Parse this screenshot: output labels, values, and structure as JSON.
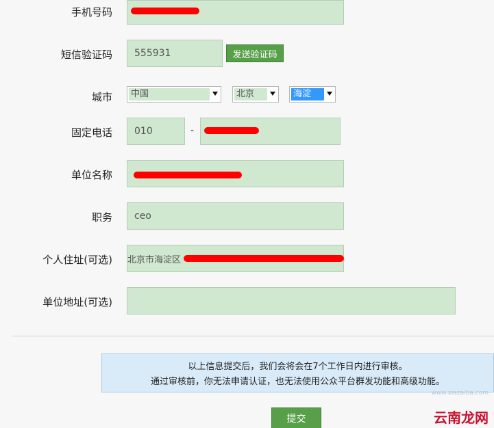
{
  "form": {
    "phone": {
      "label": "手机号码",
      "value": ""
    },
    "sms_code": {
      "label": "短信验证码",
      "value": "555931",
      "send_button": "发送验证码"
    },
    "city": {
      "label": "城市",
      "country": "中国",
      "province": "北京",
      "district": "海淀"
    },
    "landline": {
      "label": "固定电话",
      "area_code": "010",
      "separator": "-",
      "number": ""
    },
    "company_name": {
      "label": "单位名称",
      "value": ""
    },
    "position": {
      "label": "职务",
      "value": "ceo"
    },
    "home_address": {
      "label": "个人住址(可选)",
      "value_prefix": "北京市海淀区"
    },
    "company_address": {
      "label": "单位地址(可选)",
      "value": ""
    }
  },
  "notice": {
    "line1": "以上信息提交后，我们会将会在7个工作日内进行审核。",
    "line2": "通过审核前，你无法申请认证，也无法使用公众平台群发功能和高级功能。"
  },
  "submit_label": "提交",
  "watermark": {
    "brand": "云南龙网",
    "url": "www.xiazaiba.com"
  },
  "colors": {
    "field_bg": "#cfe8cf",
    "button_green": "#57a049",
    "notice_bg": "#d9ebf9",
    "redaction": "#ff0000"
  }
}
